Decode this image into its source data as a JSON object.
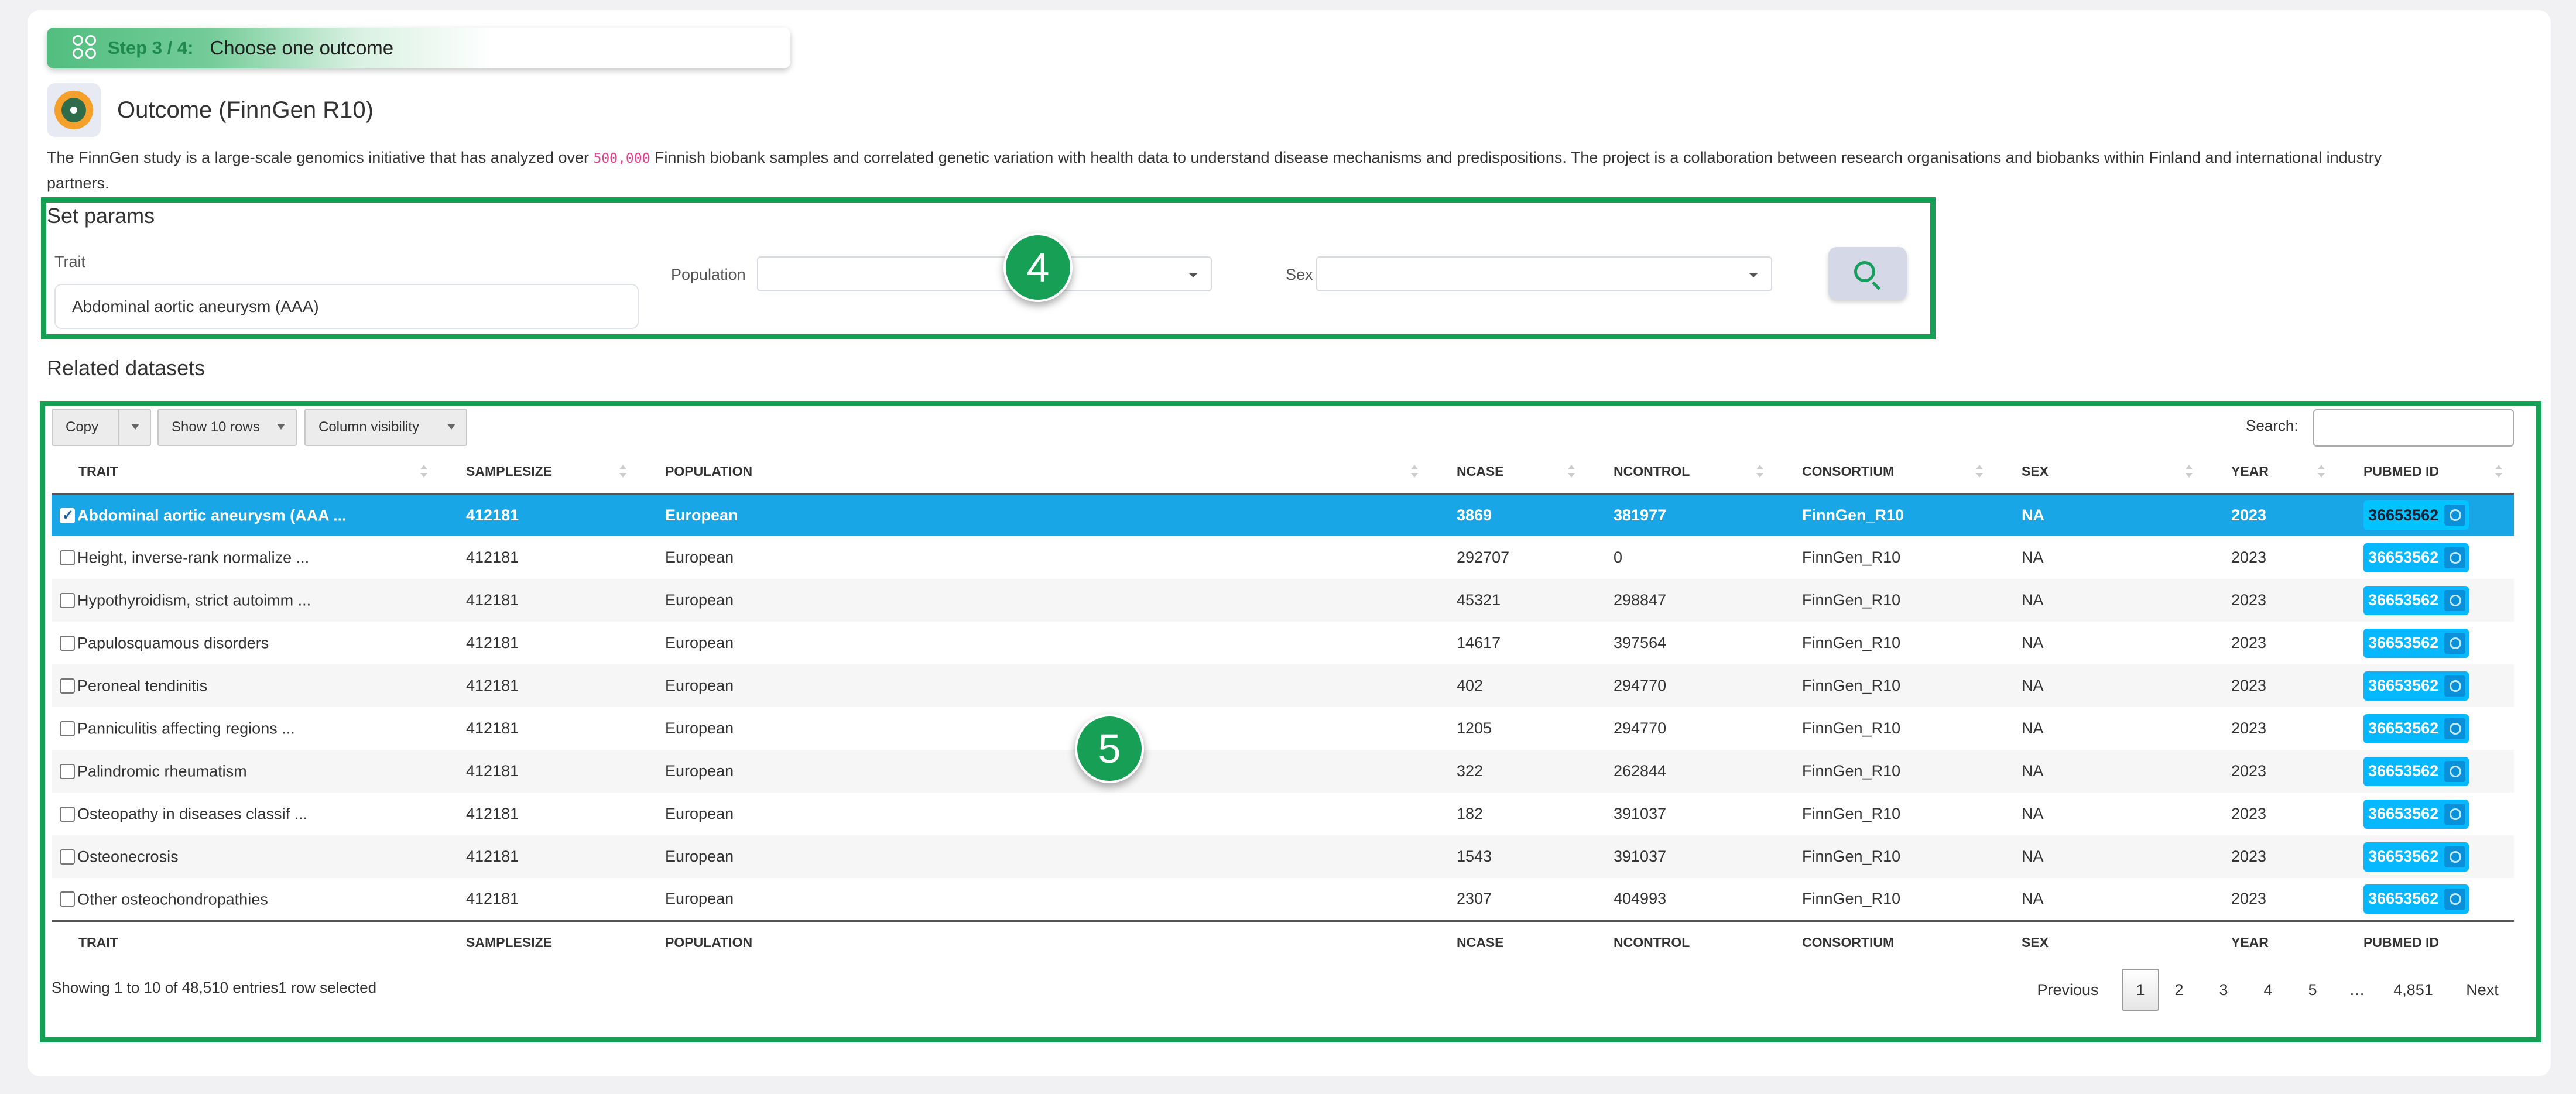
{
  "step": {
    "label": "Step 3 / 4:",
    "text": "Choose one outcome"
  },
  "outcome": {
    "title": "Outcome (FinnGen R10)",
    "description_before": "The FinnGen study is a large-scale genomics initiative that has analyzed over ",
    "description_highlight": "500,000",
    "description_after": " Finnish biobank samples and correlated genetic variation with health data to understand disease mechanisms and predispositions. The project is a collaboration between research organisations and biobanks within Finland and international industry partners."
  },
  "params": {
    "title": "Set params",
    "trait_label": "Trait",
    "trait_value": "Abdominal aortic aneurysm (AAA)",
    "population_label": "Population",
    "population_value": "",
    "sex_label": "Sex",
    "sex_value": "",
    "badge": "4"
  },
  "datasets": {
    "title": "Related datasets",
    "badge": "5",
    "buttons": {
      "copy": "Copy",
      "show_rows": "Show 10 rows",
      "column_visibility": "Column visibility"
    },
    "search_label": "Search:",
    "search_value": "",
    "columns": [
      "TRAIT",
      "SAMPLESIZE",
      "POPULATION",
      "NCASE",
      "NCONTROL",
      "CONSORTIUM",
      "SEX",
      "YEAR",
      "PUBMED ID"
    ],
    "rows": [
      {
        "trait": "Abdominal aortic aneurysm (AAA  ...",
        "samplesize": "412181",
        "population": "European",
        "ncase": "3869",
        "ncontrol": "381977",
        "consortium": "FinnGen_R10",
        "sex": "NA",
        "year": "2023",
        "pubmed": "36653562",
        "selected": true
      },
      {
        "trait": "Height, inverse-rank normalize  ...",
        "samplesize": "412181",
        "population": "European",
        "ncase": "292707",
        "ncontrol": "0",
        "consortium": "FinnGen_R10",
        "sex": "NA",
        "year": "2023",
        "pubmed": "36653562",
        "selected": false
      },
      {
        "trait": "Hypothyroidism, strict autoimm  ...",
        "samplesize": "412181",
        "population": "European",
        "ncase": "45321",
        "ncontrol": "298847",
        "consortium": "FinnGen_R10",
        "sex": "NA",
        "year": "2023",
        "pubmed": "36653562",
        "selected": false
      },
      {
        "trait": "Papulosquamous disorders",
        "samplesize": "412181",
        "population": "European",
        "ncase": "14617",
        "ncontrol": "397564",
        "consortium": "FinnGen_R10",
        "sex": "NA",
        "year": "2023",
        "pubmed": "36653562",
        "selected": false
      },
      {
        "trait": "Peroneal tendinitis",
        "samplesize": "412181",
        "population": "European",
        "ncase": "402",
        "ncontrol": "294770",
        "consortium": "FinnGen_R10",
        "sex": "NA",
        "year": "2023",
        "pubmed": "36653562",
        "selected": false
      },
      {
        "trait": "Panniculitis affecting regions  ...",
        "samplesize": "412181",
        "population": "European",
        "ncase": "1205",
        "ncontrol": "294770",
        "consortium": "FinnGen_R10",
        "sex": "NA",
        "year": "2023",
        "pubmed": "36653562",
        "selected": false
      },
      {
        "trait": "Palindromic rheumatism",
        "samplesize": "412181",
        "population": "European",
        "ncase": "322",
        "ncontrol": "262844",
        "consortium": "FinnGen_R10",
        "sex": "NA",
        "year": "2023",
        "pubmed": "36653562",
        "selected": false
      },
      {
        "trait": "Osteopathy in diseases classif  ...",
        "samplesize": "412181",
        "population": "European",
        "ncase": "182",
        "ncontrol": "391037",
        "consortium": "FinnGen_R10",
        "sex": "NA",
        "year": "2023",
        "pubmed": "36653562",
        "selected": false
      },
      {
        "trait": "Osteonecrosis",
        "samplesize": "412181",
        "population": "European",
        "ncase": "1543",
        "ncontrol": "391037",
        "consortium": "FinnGen_R10",
        "sex": "NA",
        "year": "2023",
        "pubmed": "36653562",
        "selected": false
      },
      {
        "trait": "Other osteochondropathies",
        "samplesize": "412181",
        "population": "European",
        "ncase": "2307",
        "ncontrol": "404993",
        "consortium": "FinnGen_R10",
        "sex": "NA",
        "year": "2023",
        "pubmed": "36653562",
        "selected": false
      }
    ],
    "info": "Showing 1 to 10 of 48,510 entries1 row selected",
    "pagination": [
      "Previous",
      "1",
      "2",
      "3",
      "4",
      "5",
      "…",
      "4,851",
      "Next"
    ],
    "current_page": "1"
  },
  "colors": {
    "accent_green": "#179f55",
    "selected_row": "#19a6e6",
    "pubmed_badge": "#06b8ff"
  }
}
